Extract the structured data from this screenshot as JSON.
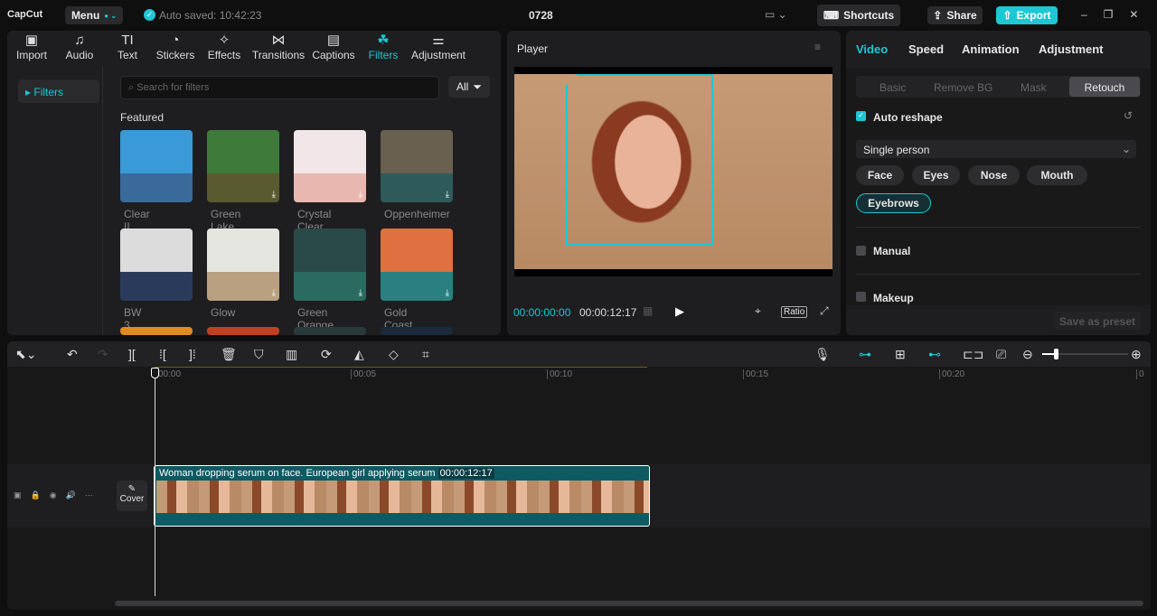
{
  "app": {
    "logo": "CapCut",
    "menu": "Menu",
    "autosave": "Auto saved: 10:42:23",
    "project": "0728",
    "shortcuts": "Shortcuts",
    "share": "Share",
    "export": "Export"
  },
  "media_tabs": [
    {
      "label": "Import",
      "icon": "▣"
    },
    {
      "label": "Audio",
      "icon": "♫"
    },
    {
      "label": "Text",
      "icon": "TI"
    },
    {
      "label": "Stickers",
      "icon": "◔"
    },
    {
      "label": "Effects",
      "icon": "✧"
    },
    {
      "label": "Transitions",
      "icon": "⋈"
    },
    {
      "label": "Captions",
      "icon": "▤"
    },
    {
      "label": "Filters",
      "icon": "☘"
    },
    {
      "label": "Adjustment",
      "icon": "⚌"
    }
  ],
  "filters": {
    "sidebar": "Filters",
    "search_placeholder": "Search for filters",
    "all": "All",
    "section": "Featured",
    "items": [
      {
        "name": "Clear II",
        "c1": "#3a9ad8",
        "c2": "#3a6a9a"
      },
      {
        "name": "Green Lake",
        "c1": "#3e7a3a",
        "c2": "#5a5a30"
      },
      {
        "name": "Crystal Clear",
        "c1": "#f2e6e8",
        "c2": "#e8b8b0"
      },
      {
        "name": "Oppenheimer",
        "c1": "#6a6050",
        "c2": "#2e5a5a"
      },
      {
        "name": "BW 3",
        "c1": "#dcdcdc",
        "c2": "#2a3a5a"
      },
      {
        "name": "Glow",
        "c1": "#e6e6e0",
        "c2": "#b8a080"
      },
      {
        "name": "Green Orange",
        "c1": "#2a4a4a",
        "c2": "#2a6a60"
      },
      {
        "name": "Gold Coast",
        "c1": "#e07040",
        "c2": "#2a8080"
      }
    ]
  },
  "player": {
    "title": "Player",
    "current": "00:00:00:00",
    "total": "00:00:12:17",
    "ratio": "Ratio"
  },
  "inspector": {
    "tabs": [
      "Video",
      "Speed",
      "Animation",
      "Adjustment"
    ],
    "subtabs": [
      "Basic",
      "Remove BG",
      "Mask",
      "Retouch"
    ],
    "auto_reshape": "Auto reshape",
    "person": "Single person",
    "parts": [
      "Face",
      "Eyes",
      "Nose",
      "Mouth",
      "Eyebrows"
    ],
    "manual": "Manual",
    "makeup": "Makeup",
    "save_preset": "Save as preset"
  },
  "timeline": {
    "ticks": [
      "00:00",
      "00:05",
      "00:10",
      "00:15",
      "00:20",
      "0"
    ],
    "clip_title": "Woman dropping serum on face. European girl applying serum",
    "clip_duration": "00:00:12:17",
    "cover": "Cover"
  },
  "colors": {
    "accent": "#1fc7d4",
    "clip": "#0e5a62"
  }
}
